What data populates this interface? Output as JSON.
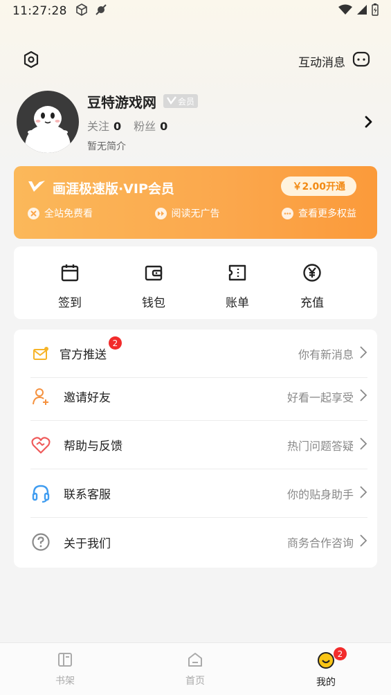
{
  "status_bar": {
    "time": "11:27:28"
  },
  "header": {
    "messages_label": "互动消息"
  },
  "profile": {
    "name": "豆特游戏网",
    "vip_tag": "会员",
    "follow_label": "关注",
    "follow_count": "0",
    "fans_label": "粉丝",
    "fans_count": "0",
    "bio": "暂无简介"
  },
  "vip_card": {
    "title": "画涯极速版·VIP会员",
    "open_button": "￥2.00开通",
    "benefits": [
      "全站免费看",
      "阅读无广告",
      "查看更多权益"
    ]
  },
  "quick_actions": [
    {
      "label": "签到",
      "icon": "calendar-icon"
    },
    {
      "label": "钱包",
      "icon": "wallet-icon"
    },
    {
      "label": "账单",
      "icon": "ticket-icon"
    },
    {
      "label": "充值",
      "icon": "yen-icon"
    }
  ],
  "menu": [
    {
      "label": "官方推送",
      "hint": "你有新消息",
      "badge": "2",
      "icon": "mail-icon"
    },
    {
      "label": "邀请好友",
      "hint": "好看一起享受",
      "icon": "add-user-icon"
    },
    {
      "label": "帮助与反馈",
      "hint": "热门问题答疑",
      "icon": "heart-handshake-icon"
    },
    {
      "label": "联系客服",
      "hint": "你的贴身助手",
      "icon": "headset-icon"
    },
    {
      "label": "关于我们",
      "hint": "商务合作咨询",
      "icon": "question-icon"
    }
  ],
  "tabbar": [
    {
      "label": "书架",
      "icon": "book-icon"
    },
    {
      "label": "首页",
      "icon": "home-icon"
    },
    {
      "label": "我的",
      "icon": "smile-icon",
      "badge": "2",
      "active": true
    }
  ],
  "colors": {
    "accent": "#fba74c",
    "badge": "#f22b2b",
    "vip_text": "#f28a14"
  }
}
